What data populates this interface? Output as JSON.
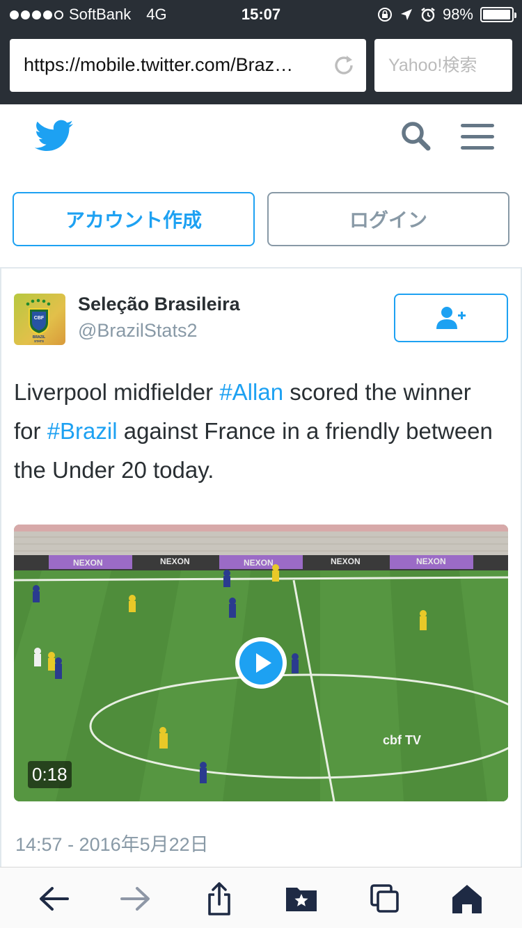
{
  "status_bar": {
    "carrier": "SoftBank",
    "network": "4G",
    "time": "15:07",
    "battery": "98%",
    "battery_level": 0.98,
    "signal_bars": 4,
    "signal_max": 5
  },
  "browser": {
    "url": "https://mobile.twitter.com/Braz…",
    "search_placeholder": "Yahoo!検索"
  },
  "header": {
    "logo_icon": "twitter-bird-icon",
    "search_icon": "search-icon",
    "menu_icon": "hamburger-menu-icon"
  },
  "auth": {
    "signup_label": "アカウント作成",
    "login_label": "ログイン"
  },
  "tweet": {
    "display_name": "Seleção Brasileira",
    "handle": "@BrazilStats2",
    "follow_icon": "follow-user-icon",
    "text_parts": {
      "p1": "Liverpool midfielder ",
      "tag1": "#Allan",
      "p2": " scored the winner for ",
      "tag2": "#Brazil",
      "p3": " against France in a friendly between the Under 20 today."
    },
    "video": {
      "duration": "0:18",
      "watermark": "cbf TV",
      "board_text": "NEXON"
    },
    "timestamp": "14:57 - 2016年5月22日"
  },
  "toolbar": {
    "back_icon": "back-arrow-icon",
    "forward_icon": "forward-arrow-icon",
    "share_icon": "share-icon",
    "bookmarks_icon": "bookmarks-icon",
    "tabs_icon": "tabs-icon",
    "home_icon": "home-icon"
  },
  "colors": {
    "twitter_blue": "#1da1f2",
    "gray": "#8899a6",
    "chrome_dark": "#292f36",
    "pitch_green": "#4d8a3a"
  }
}
